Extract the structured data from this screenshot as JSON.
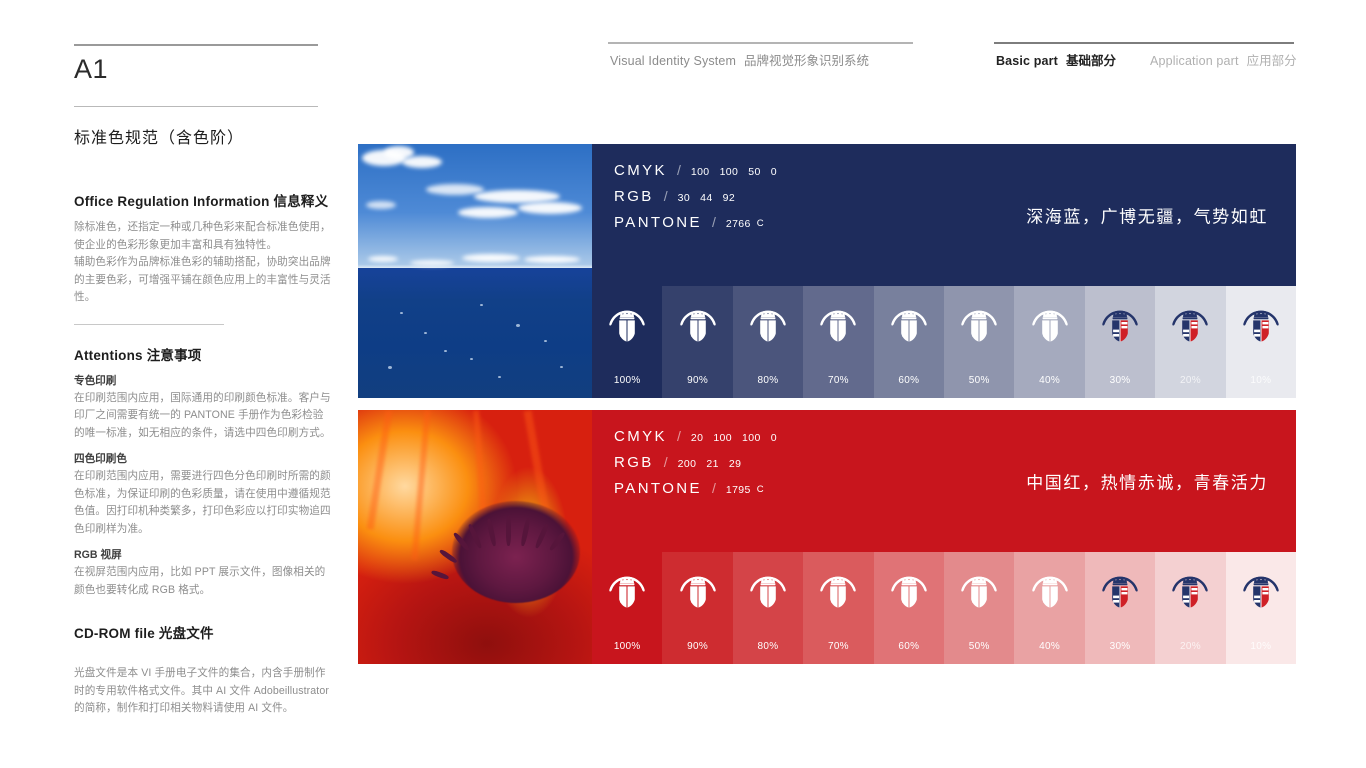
{
  "header": {
    "code": "A1",
    "nav": [
      {
        "name": "visual-identity-system",
        "en": "Visual Identity System",
        "cn": "品牌视觉形象识别系统",
        "active": false
      },
      {
        "name": "basic-part",
        "en": "Basic part",
        "cn": "基础部分",
        "active": true
      },
      {
        "name": "application-part",
        "en": "Application part",
        "cn": "应用部分",
        "active": false
      }
    ]
  },
  "sidebar": {
    "page_title": "标准色规范（含色阶）",
    "sections": [
      {
        "name": "office-regulation-information",
        "heading_en": "Office Regulation Information",
        "heading_cn": "信息释义",
        "paragraphs": [
          "除标准色，还指定一种或几种色彩来配合标准色使用，使企业的色彩形象更加丰富和具有独特性。",
          "辅助色彩作为品牌标准色彩的辅助搭配，协助突出品牌的主要色彩，可增强平铺在颜色应用上的丰富性与灵活性。"
        ]
      },
      {
        "name": "attentions",
        "heading_en": "Attentions",
        "heading_cn": "注意事项",
        "items": [
          {
            "sub": "专色印刷",
            "text": "在印刷范围内应用，国际通用的印刷颜色标准。客户与印厂之间需要有统一的 PANTONE 手册作为色彩检验的唯一标准，如无相应的条件，请选中四色印刷方式。"
          },
          {
            "sub": "四色印刷色",
            "text": "在印刷范围内应用，需要进行四色分色印刷时所需的颜色标准，为保证印刷的色彩质量，请在使用中遵循规范色值。因打印机种类繁多，打印色彩应以打印实物追四色印刷样为准。"
          },
          {
            "sub": "RGB 视屏",
            "text": "在视屏范围内应用，比如 PPT 展示文件，图像相关的颜色也要转化成 RGB 格式。"
          }
        ]
      },
      {
        "name": "cd-rom-file",
        "heading_en": "CD-ROM file",
        "heading_cn": "光盘文件",
        "paragraphs": [
          "光盘文件是本 VI 手册电子文件的集合，内含手册制作时的专用软件格式文件。其中 AI 文件 Adobeillustrator 的简称，制作和打印相关物料请使用 AI 文件。"
        ]
      }
    ]
  },
  "palettes": [
    {
      "name": "deep-sea-blue",
      "photo": "ocean-photo",
      "base_hex": "#1e2c5c",
      "specs": [
        {
          "label": "CMYK",
          "values": [
            "100",
            "100",
            "50",
            "0"
          ]
        },
        {
          "label": "RGB",
          "values": [
            "30",
            "44",
            "92"
          ]
        },
        {
          "label": "PANTONE",
          "values": [
            "2766"
          ],
          "suffix": "C"
        }
      ],
      "slogan": "深海蓝，广博无疆，气势如虹",
      "tints": [
        {
          "pct": "100%",
          "hex": "#1e2c5c",
          "logo": "white"
        },
        {
          "pct": "90%",
          "hex": "#35416c",
          "logo": "white"
        },
        {
          "pct": "80%",
          "hex": "#4b557c",
          "logo": "white"
        },
        {
          "pct": "70%",
          "hex": "#626a8d",
          "logo": "white"
        },
        {
          "pct": "60%",
          "hex": "#78809d",
          "logo": "white"
        },
        {
          "pct": "50%",
          "hex": "#8f95ad",
          "logo": "white"
        },
        {
          "pct": "40%",
          "hex": "#a5aabe",
          "logo": "white"
        },
        {
          "pct": "30%",
          "hex": "#bcbfce",
          "logo": "color"
        },
        {
          "pct": "20%",
          "hex": "#d2d5df",
          "logo": "color"
        },
        {
          "pct": "10%",
          "hex": "#e9eaef",
          "logo": "color"
        }
      ]
    },
    {
      "name": "china-red",
      "photo": "poppy-photo",
      "base_hex": "#c8151d",
      "specs": [
        {
          "label": "CMYK",
          "values": [
            "20",
            "100",
            "100",
            "0"
          ]
        },
        {
          "label": "RGB",
          "values": [
            "200",
            "21",
            "29"
          ]
        },
        {
          "label": "PANTONE",
          "values": [
            "1795"
          ],
          "suffix": "C"
        }
      ],
      "slogan": "中国红，热情赤诚，青春活力",
      "tints": [
        {
          "pct": "100%",
          "hex": "#c8151d",
          "logo": "white"
        },
        {
          "pct": "90%",
          "hex": "#ce2c30",
          "logo": "white"
        },
        {
          "pct": "80%",
          "hex": "#d44448",
          "logo": "white"
        },
        {
          "pct": "70%",
          "hex": "#da5b5d",
          "logo": "white"
        },
        {
          "pct": "60%",
          "hex": "#e07376",
          "logo": "white"
        },
        {
          "pct": "50%",
          "hex": "#e38a8c",
          "logo": "white"
        },
        {
          "pct": "40%",
          "hex": "#e9a2a3",
          "logo": "white"
        },
        {
          "pct": "30%",
          "hex": "#efb9ba",
          "logo": "color"
        },
        {
          "pct": "20%",
          "hex": "#f4d0d1",
          "logo": "color"
        },
        {
          "pct": "10%",
          "hex": "#fae8e8",
          "logo": "color"
        }
      ]
    }
  ],
  "logo": {
    "name": "brand-crest-emblem",
    "colors": {
      "navy": "#25356b",
      "red": "#cf2027",
      "white": "#ffffff"
    }
  }
}
